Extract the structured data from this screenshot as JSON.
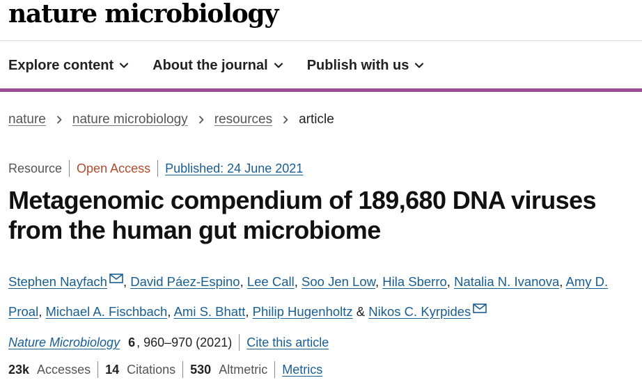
{
  "header": {
    "logo": "nature microbiology",
    "nav": [
      {
        "label": "Explore content"
      },
      {
        "label": "About the journal"
      },
      {
        "label": "Publish with us"
      }
    ],
    "accent_color": "#9b4d96"
  },
  "breadcrumb": {
    "items": [
      "nature",
      "nature microbiology",
      "resources"
    ],
    "current": "article"
  },
  "article": {
    "type": "Resource",
    "access": "Open Access",
    "published": "Published: 24 June 2021",
    "title": "Metagenomic compendium of 189,680 DNA viruses from the human gut microbiome",
    "authors": [
      "Stephen Nayfach",
      "David Páez-Espino",
      "Lee Call",
      "Soo Jen Low",
      "Hila Sberro",
      "Natalia N. Ivanova",
      "Amy D. Proal",
      "Michael A. Fischbach",
      "Ami S. Bhatt",
      "Philip Hugenholtz",
      "Nikos C. Kyrpides"
    ],
    "separators": {
      "comma": ", ",
      "ampersand": " & "
    },
    "journal": "Nature Microbiology",
    "volume": "6",
    "pages": ", 960–970 (2021)",
    "cite_label": "Cite this article"
  },
  "metrics": {
    "accesses_value": "23k",
    "accesses_label": "Accesses",
    "citations_value": "14",
    "citations_label": "Citations",
    "altmetric_value": "530",
    "altmetric_label": "Altmetric",
    "metrics_link": "Metrics"
  }
}
